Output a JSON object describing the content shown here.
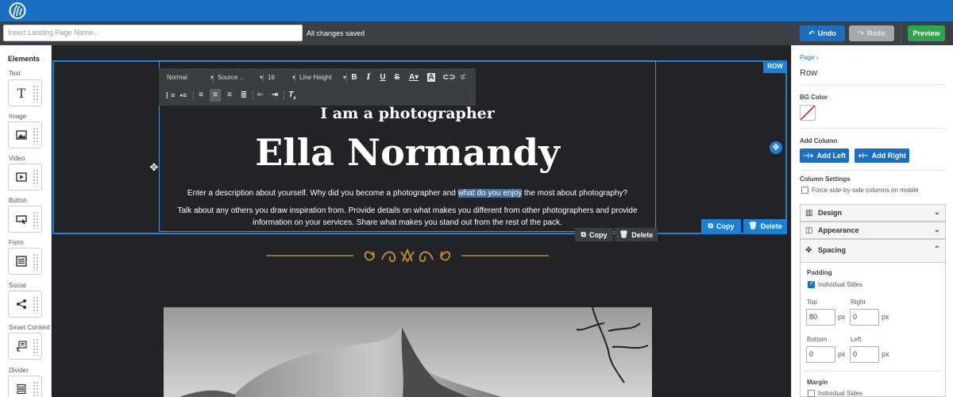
{
  "topbar": {
    "logo": "app-logo"
  },
  "toolbar": {
    "page_name_placeholder": "Insert Landing Page Name...",
    "status": "All changes saved",
    "undo_label": "Undo",
    "redo_label": "Redo",
    "preview_label": "Preview"
  },
  "elements": {
    "title": "Elements",
    "items": [
      {
        "label": "Text",
        "icon": "text-icon"
      },
      {
        "label": "Image",
        "icon": "image-icon"
      },
      {
        "label": "Video",
        "icon": "video-icon"
      },
      {
        "label": "Button",
        "icon": "button-icon"
      },
      {
        "label": "Form",
        "icon": "form-icon"
      },
      {
        "label": "Social",
        "icon": "share-icon"
      },
      {
        "label": "Smart Content",
        "icon": "smart-content-icon"
      },
      {
        "label": "Divider",
        "icon": "divider-icon"
      }
    ]
  },
  "editor": {
    "format": "Normal",
    "font": "Source ...",
    "size": "16",
    "line_height": "Line Height"
  },
  "canvas": {
    "row_tag": "ROW",
    "subtitle": "I am a photographer",
    "name": "Ella Normandy",
    "desc1_pre": "Enter a description about yourself. Why did you become a photographer and ",
    "desc1_hl": "what do you enjoy",
    "desc1_post": " the most about photography?",
    "desc2": "Talk about any others you draw inspiration from. Provide details on what makes you different from other photographers and provide information on your services. Share what makes you stand out from the rest of the pack.",
    "copy_label": "Copy",
    "delete_label": "Delete",
    "accent_color": "#b8863b"
  },
  "panel": {
    "breadcrumb": "Page ›",
    "title": "Row",
    "bg_color_label": "BG Color",
    "add_column_label": "Add Column",
    "add_left": "Add Left",
    "add_right": "Add Right",
    "column_settings_label": "Column Settings",
    "force_label": "Force side-by-side columns on mobile",
    "design": "Design",
    "appearance": "Appearance",
    "spacing": "Spacing",
    "padding_label": "Padding",
    "individual_sides": "Individual Sides",
    "top_label": "Top",
    "right_label": "Right",
    "bottom_label": "Bottom",
    "left_label": "Left",
    "top": "80",
    "right": "0",
    "bottom": "0",
    "left": "0",
    "unit": "px",
    "margin_label": "Margin",
    "margin_individual": "Individual Sides"
  },
  "colors": {
    "brand": "#1b6fc2",
    "preview": "#2ea44f",
    "canvas_bg": "#222326"
  }
}
